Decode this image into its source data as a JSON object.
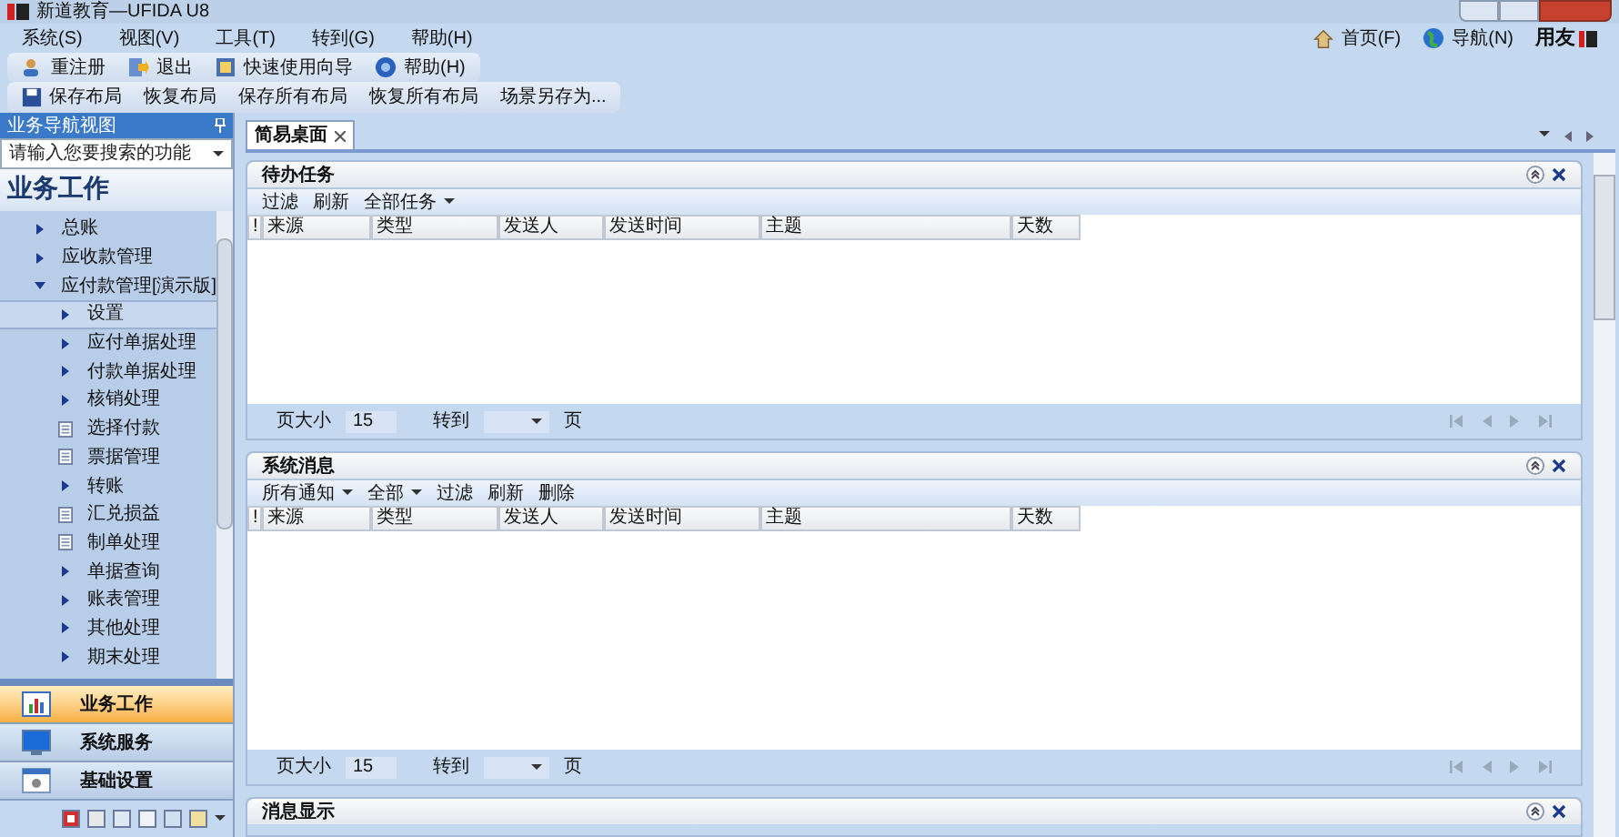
{
  "window": {
    "title": "新道教育—UFIDA U8"
  },
  "menu": [
    {
      "label": "系统(S)"
    },
    {
      "label": "视图(V)"
    },
    {
      "label": "工具(T)"
    },
    {
      "label": "转到(G)"
    },
    {
      "label": "帮助(H)"
    }
  ],
  "toolbar": [
    {
      "label": "重注册",
      "kind": "user"
    },
    {
      "label": "退出",
      "kind": "exit"
    },
    {
      "label": "快速使用向导",
      "kind": "wizard"
    },
    {
      "label": "帮助(H)",
      "kind": "help"
    }
  ],
  "layout_toolbar": [
    {
      "label": "保存布局",
      "kind": "save"
    },
    {
      "label": "恢复布局"
    },
    {
      "label": "保存所有布局"
    },
    {
      "label": "恢复所有布局"
    },
    {
      "label": "场景另存为..."
    }
  ],
  "header_links": [
    {
      "label": "首页(F)",
      "kind": "home"
    },
    {
      "label": "导航(N)",
      "kind": "globe"
    }
  ],
  "brand": "用友",
  "nav": {
    "title": "业务导航视图",
    "search_placeholder": "请输入您要搜索的功能",
    "section": "业务工作",
    "tree": [
      {
        "label": "总账",
        "expanded": false,
        "kind": "folder"
      },
      {
        "label": "应收款管理",
        "expanded": false,
        "kind": "folder"
      },
      {
        "label": "应付款管理[演示版]",
        "expanded": true,
        "kind": "folder",
        "children": [
          {
            "label": "设置",
            "kind": "folder",
            "expanded": false,
            "selected": true
          },
          {
            "label": "应付单据处理",
            "kind": "folder",
            "expanded": false,
            "selected": false
          },
          {
            "label": "付款单据处理",
            "kind": "folder",
            "expanded": false,
            "selected": false
          },
          {
            "label": "核销处理",
            "kind": "folder",
            "expanded": false,
            "selected": false
          },
          {
            "label": "选择付款",
            "kind": "doc",
            "selected": false
          },
          {
            "label": "票据管理",
            "kind": "doc",
            "selected": false
          },
          {
            "label": "转账",
            "kind": "folder",
            "expanded": false,
            "selected": false
          },
          {
            "label": "汇兑损益",
            "kind": "doc",
            "selected": false
          },
          {
            "label": "制单处理",
            "kind": "doc",
            "selected": false
          },
          {
            "label": "单据查询",
            "kind": "folder",
            "expanded": false,
            "selected": false
          },
          {
            "label": "账表管理",
            "kind": "folder",
            "expanded": false,
            "selected": false
          },
          {
            "label": "其他处理",
            "kind": "folder",
            "expanded": false,
            "selected": false
          },
          {
            "label": "期末处理",
            "kind": "folder",
            "expanded": false,
            "selected": false
          }
        ]
      }
    ],
    "buttons": [
      {
        "label": "业务工作",
        "selected": true,
        "kind": "chart"
      },
      {
        "label": "系统服务",
        "selected": false,
        "kind": "monitor"
      },
      {
        "label": "基础设置",
        "selected": false,
        "kind": "gear"
      }
    ]
  },
  "tabs": [
    {
      "label": "简易桌面",
      "selected": true
    }
  ],
  "panels": [
    {
      "title": "待办任务",
      "tools": [
        {
          "label": "过滤",
          "dropdown": false
        },
        {
          "label": "刷新",
          "dropdown": false
        },
        {
          "label": "全部任务",
          "dropdown": true
        }
      ],
      "columns": [
        "!",
        "来源",
        "类型",
        "发送人",
        "发送时间",
        "主题",
        "天数"
      ],
      "footer": {
        "page_size_label": "页大小",
        "page_size": "15",
        "goto_label": "转到",
        "page_label": "页"
      }
    },
    {
      "title": "系统消息",
      "tools": [
        {
          "label": "所有通知",
          "dropdown": true
        },
        {
          "label": "全部",
          "dropdown": true
        },
        {
          "label": "过滤",
          "dropdown": false
        },
        {
          "label": "刷新",
          "dropdown": false
        },
        {
          "label": "删除",
          "dropdown": false
        }
      ],
      "columns": [
        "!",
        "来源",
        "类型",
        "发送人",
        "发送时间",
        "主题",
        "天数"
      ],
      "footer": {
        "page_size_label": "页大小",
        "page_size": "15",
        "goto_label": "转到",
        "page_label": "页"
      }
    }
  ],
  "message_panel": {
    "title": "消息显示"
  }
}
